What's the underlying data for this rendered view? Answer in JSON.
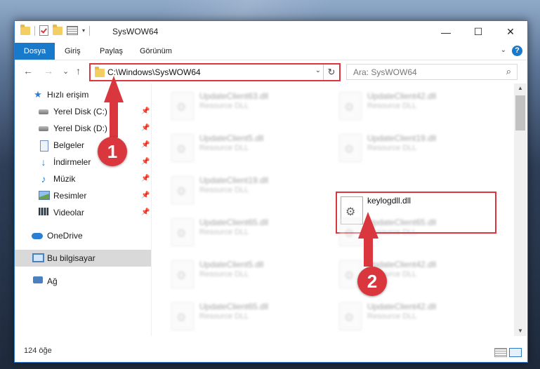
{
  "window": {
    "title": "SysWOW64"
  },
  "titlebar": {
    "minimize": "—",
    "maximize": "☐",
    "close": "✕"
  },
  "ribbon": {
    "tabs": [
      {
        "label": "Dosya",
        "active": true
      },
      {
        "label": "Giriş"
      },
      {
        "label": "Paylaş"
      },
      {
        "label": "Görünüm"
      }
    ],
    "help": "?"
  },
  "nav": {
    "back": "←",
    "forward": "→",
    "recent": "⌄",
    "up": "↑",
    "address": "C:\\Windows\\SysWOW64",
    "refresh": "↻",
    "search_placeholder": "Ara: SysWOW64"
  },
  "sidebar": {
    "items": [
      {
        "label": "Hızlı erişim",
        "icon": "star-icon",
        "pinned": false
      },
      {
        "label": "Yerel Disk (C:)",
        "icon": "disk-icon",
        "pinned": true
      },
      {
        "label": "Yerel Disk (D:)",
        "icon": "disk-icon",
        "pinned": true
      },
      {
        "label": "Belgeler",
        "icon": "document-icon",
        "pinned": true
      },
      {
        "label": "İndirmeler",
        "icon": "download-icon",
        "pinned": true
      },
      {
        "label": "Müzik",
        "icon": "music-icon",
        "pinned": true
      },
      {
        "label": "Resimler",
        "icon": "pictures-icon",
        "pinned": true
      },
      {
        "label": "Videolar",
        "icon": "videos-icon",
        "pinned": true
      },
      {
        "label": "OneDrive",
        "icon": "onedrive-icon",
        "pinned": false
      },
      {
        "label": "Bu bilgisayar",
        "icon": "computer-icon",
        "pinned": false,
        "selected": true
      },
      {
        "label": "Ağ",
        "icon": "network-icon",
        "pinned": false
      }
    ],
    "pin_glyph": "📌"
  },
  "files": {
    "left": [
      {
        "name": "UpdateClient63.dll",
        "desc": "Resource DLL"
      },
      {
        "name": "UpdateClient5.dll",
        "desc": "Resource DLL"
      },
      {
        "name": "UpdateClient19.dll",
        "desc": "Resource DLL"
      },
      {
        "name": "UpdateClient65.dll",
        "desc": "Resource DLL"
      },
      {
        "name": "UpdateClient5.dll",
        "desc": "Resource DLL"
      },
      {
        "name": "UpdateClient65.dll",
        "desc": "Resource DLL"
      }
    ],
    "right": [
      {
        "name": "UpdateClient42.dll",
        "desc": "Resource DLL"
      },
      {
        "name": "UpdateClient19.dll",
        "desc": "Resource DLL"
      },
      {
        "name": "UpdateClient65.dll",
        "desc": "Resource DLL"
      },
      {
        "name": "UpdateClient42.dll",
        "desc": "Resource DLL"
      },
      {
        "name": "UpdateClient42.dll",
        "desc": "Resource DLL"
      }
    ],
    "highlighted": {
      "name": "keylogdll.dll"
    }
  },
  "status": {
    "count": "124 öğe"
  },
  "annotations": {
    "step1": "1",
    "step2": "2",
    "color": "#d9363e"
  }
}
